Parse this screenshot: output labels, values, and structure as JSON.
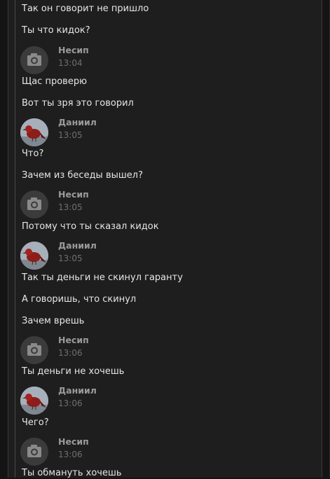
{
  "messages": [
    "Так он говорит не пришло",
    "Ты что кидок?",
    "Щас проверю",
    "Вот ты зря это говорил",
    "Что?",
    "Зачем из беседы вышел?",
    "Потому что ты сказал кидок",
    "Так ты деньги не скинул гаранту",
    "А говоришь, что скинул",
    "Зачем врешь",
    "Ты деньги не хочешь",
    "Чего?",
    "Ты обмануть хочешь"
  ],
  "headers": [
    {
      "author": "Несип",
      "time": "13:04",
      "avatar": "camera-icon"
    },
    {
      "author": "Даниил",
      "time": "13:05",
      "avatar": "bird-avatar"
    },
    {
      "author": "Несип",
      "time": "13:05",
      "avatar": "camera-icon"
    },
    {
      "author": "Даниил",
      "time": "13:05",
      "avatar": "bird-avatar"
    },
    {
      "author": "Несип",
      "time": "13:06",
      "avatar": "camera-icon"
    },
    {
      "author": "Даниил",
      "time": "13:06",
      "avatar": "bird-avatar"
    },
    {
      "author": "Несип",
      "time": "13:06",
      "avatar": "camera-icon"
    }
  ],
  "colors": {
    "background": "#1e1e1e",
    "text": "#e6e6e6",
    "author": "#9a9a9a",
    "time": "#6f6f6f"
  }
}
